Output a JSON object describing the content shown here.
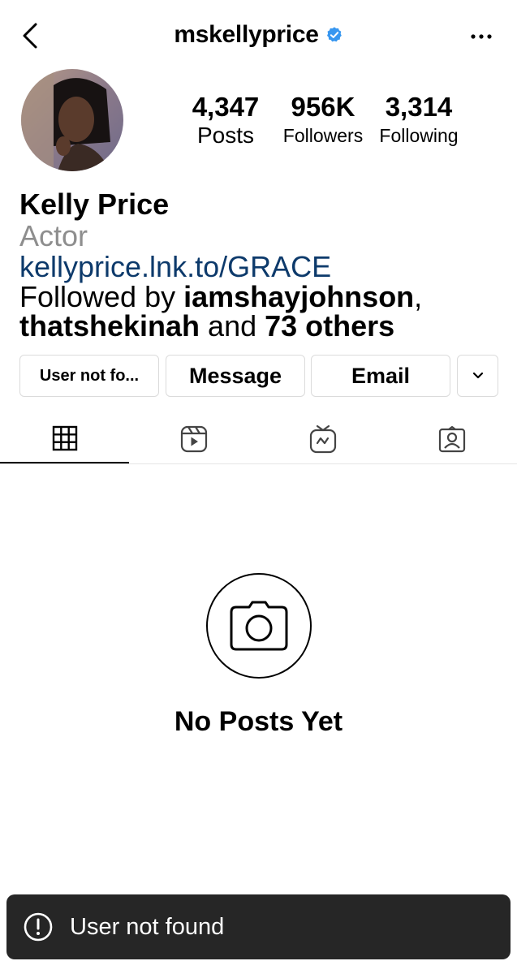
{
  "header": {
    "username": "mskellyprice",
    "verified": true,
    "back_icon": "chevron-left-icon",
    "more_icon": "more-horizontal-icon"
  },
  "stats": {
    "posts_count": "4,347",
    "posts_label": "Posts",
    "followers_count": "956K",
    "followers_label": "Followers",
    "following_count": "3,314",
    "following_label": "Following"
  },
  "bio": {
    "name": "Kelly Price",
    "category": "Actor",
    "link": "kellyprice.lnk.to/GRACE",
    "followed_prefix": "Followed by ",
    "followed_user1": "iamshayjohnson",
    "followed_sep": ",",
    "followed_user2": "thatshekinah",
    "followed_and": " and ",
    "followed_others": "73 others"
  },
  "actions": {
    "follow_label": "User not fo...",
    "message_label": "Message",
    "email_label": "Email",
    "dropdown_icon": "chevron-down-icon"
  },
  "tabs": [
    {
      "icon": "grid-icon",
      "active": true
    },
    {
      "icon": "reels-icon",
      "active": false
    },
    {
      "icon": "igtv-icon",
      "active": false
    },
    {
      "icon": "tagged-icon",
      "active": false
    }
  ],
  "empty_state": {
    "icon": "camera-icon",
    "title": "No Posts Yet"
  },
  "toast": {
    "icon": "alert-circle-icon",
    "message": "User not found"
  },
  "colors": {
    "verified_badge": "#3897f0",
    "link": "#0d3a6b",
    "secondary_text": "#8e8e8e",
    "toast_bg": "#262626",
    "border": "#dbdbdb"
  }
}
